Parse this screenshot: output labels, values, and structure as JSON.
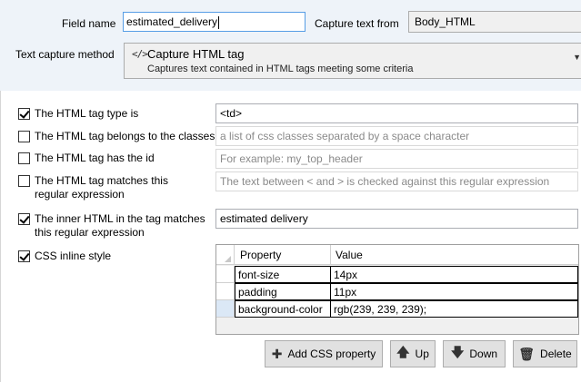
{
  "top": {
    "field_name_label": "Field name",
    "field_name_value": "estimated_delivery",
    "capture_from_label": "Capture text from",
    "capture_from_value": "Body_HTML",
    "method_label": "Text capture method",
    "method_icon": "</>",
    "method_title": "Capture HTML tag",
    "method_subtitle": "Captures text contained in HTML tags meeting some criteria"
  },
  "criteria": [
    {
      "label": "The HTML tag type is",
      "checked": true,
      "value": "<td>",
      "placeholder": ""
    },
    {
      "label": "The HTML tag belongs to the classes",
      "checked": false,
      "value": "",
      "placeholder": "a list of css classes separated by a space character"
    },
    {
      "label": "The HTML tag has the id",
      "checked": false,
      "value": "",
      "placeholder": "For example: my_top_header"
    },
    {
      "label_line1": "The HTML tag matches this",
      "label_line2": "regular expression",
      "checked": false,
      "value": "",
      "placeholder": "The text between < and > is checked against this regular expression"
    },
    {
      "label_line1": "The inner HTML in the tag matches",
      "label_line2": "this regular expression",
      "checked": true,
      "value": "estimated delivery",
      "placeholder": ""
    },
    {
      "label": "CSS inline style",
      "checked": true
    }
  ],
  "css_grid": {
    "headers": [
      "Property",
      "Value"
    ],
    "rows": [
      {
        "property": "font-size",
        "value": "14px"
      },
      {
        "property": "padding",
        "value": "11px"
      },
      {
        "property": "background-color",
        "value": "rgb(239, 239, 239);"
      }
    ]
  },
  "buttons": {
    "add": "Add CSS property",
    "up": "Up",
    "down": "Down",
    "delete": "Delete"
  },
  "icons": {
    "add": "plus-icon",
    "up": "arrow-up-icon",
    "down": "arrow-down-icon",
    "delete": "trash-icon",
    "method": "code-icon"
  }
}
